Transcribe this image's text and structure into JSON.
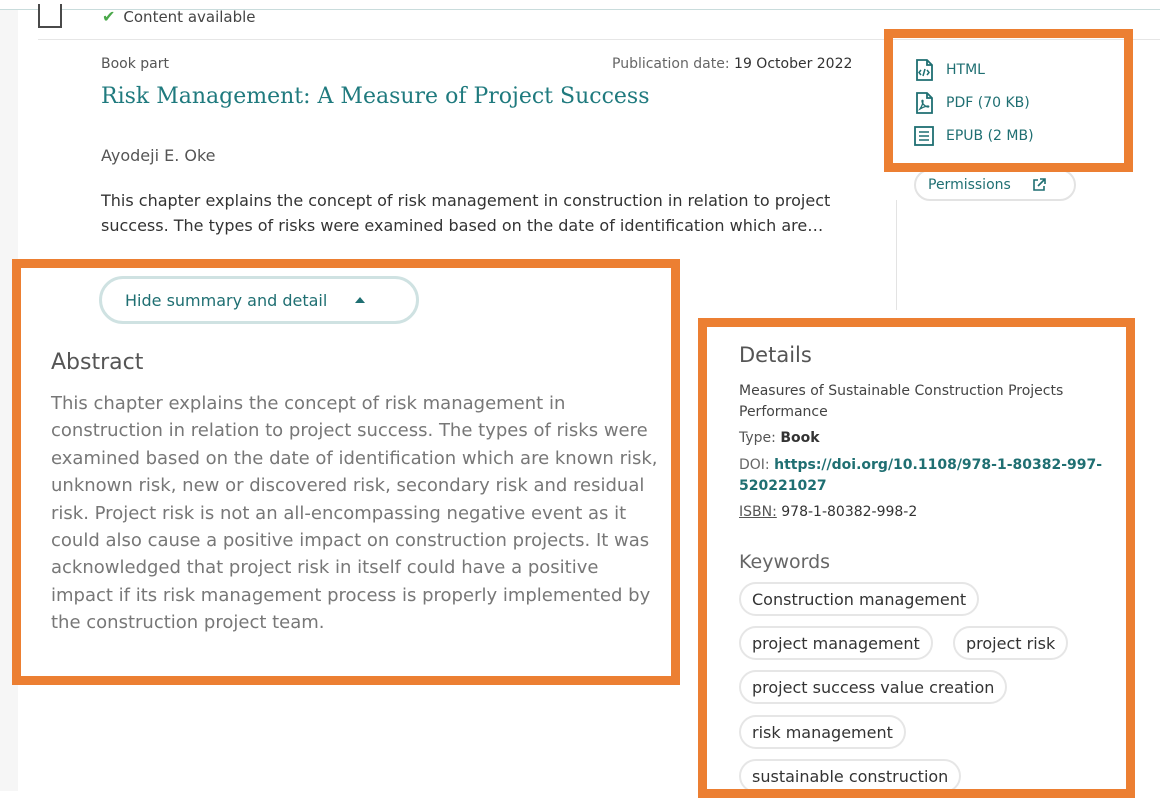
{
  "top": {
    "availability": "Content available"
  },
  "result": {
    "type": "Book part",
    "pub_label": "Publication date:",
    "pub_date": "19 October 2022",
    "title": "Risk Management: A Measure of Project Success",
    "author": "Ayodeji E. Oke",
    "snippet": "This chapter explains the concept of risk management in construction in relation to project success. The types of risks were examined based on the date of identification which are…",
    "toggle_label": "Hide summary and detail"
  },
  "downloads": [
    {
      "label": "HTML",
      "icon": "html-file-icon"
    },
    {
      "label": "PDF (70 KB)",
      "icon": "pdf-file-icon"
    },
    {
      "label": "EPUB (2 MB)",
      "icon": "epub-book-icon"
    }
  ],
  "permissions": {
    "label": "Permissions",
    "icon": "external-link-icon"
  },
  "abstract": {
    "heading": "Abstract",
    "text": "This chapter explains the concept of risk management in construction in relation to project success. The types of risks were examined based on the date of identification which are known risk, unknown risk, new or discovered risk, secondary risk and residual risk. Project risk is not an all-encompassing negative event as it could also cause a positive impact on construction projects. It was acknowledged that project risk in itself could have a positive impact if its risk management process is properly implemented by the construction project team."
  },
  "details": {
    "heading": "Details",
    "series": "Measures of Sustainable Construction Projects Performance",
    "type_label": "Type:",
    "type_value": "Book",
    "doi_label": "DOI:",
    "doi_value": "https://doi.org/10.1108/978-1-80382-997-520221027",
    "isbn_label": "ISBN:",
    "isbn_value": "978-1-80382-998-2"
  },
  "keywords": {
    "heading": "Keywords",
    "items": [
      "Construction management",
      "project management",
      "project risk",
      "project success value creation",
      "risk management",
      "sustainable construction"
    ]
  },
  "colors": {
    "accent": "#1f7a7e",
    "highlight": "#ec7f32",
    "check": "#4aa84a"
  }
}
